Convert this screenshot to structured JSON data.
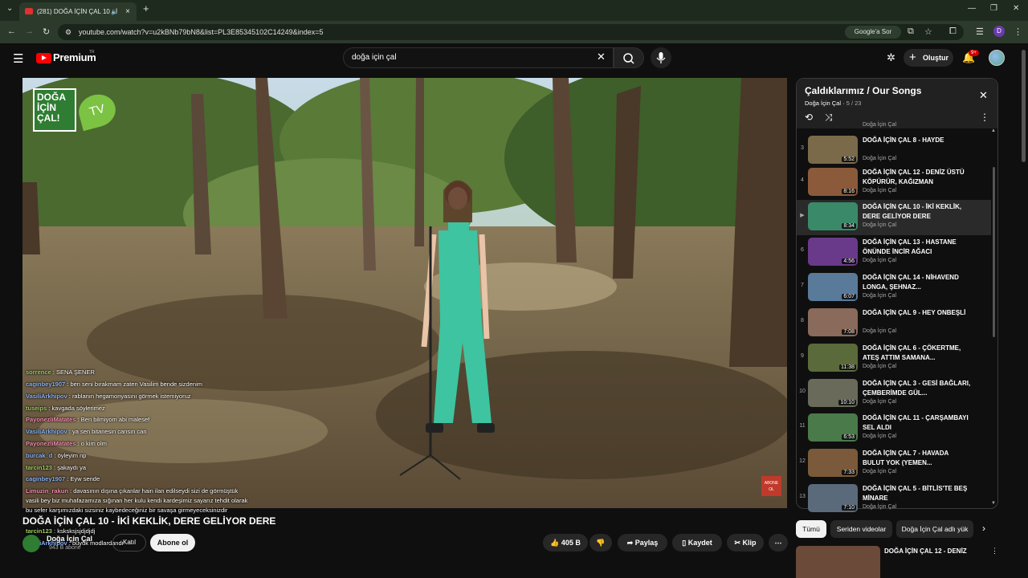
{
  "browser": {
    "tab_title": "(281) DOĞA İÇİN ÇAL 10 - İ",
    "url": "youtube.com/watch?v=u2kBNb79bN8&list=PL3E85345102C14249&index=5",
    "ask_google": "Google'a Sor",
    "profile_initial": "D"
  },
  "header": {
    "logo": "Premium",
    "logo_tr": "TR",
    "search_value": "doğa için çal",
    "create_label": "Oluştur",
    "notif_count": "9+"
  },
  "video": {
    "brand_text": "DOĞA İÇİN ÇAL!",
    "brand_tv": "TV",
    "abone_mark": "ABONE OL"
  },
  "chat": [
    {
      "user": "sorrence",
      "text": " : SENA ŞENER"
    },
    {
      "user": "caginbey1907",
      "text": " : ben seni bırakmam zaten Vasilim bende sizdenim"
    },
    {
      "user": "VasiliArkhipov",
      "text": " : rablanın hegamonyasını görmek istemiyoruz"
    },
    {
      "user": "tuseips",
      "text": " : kavgada söylerimez"
    },
    {
      "user": "PayonezliMatates",
      "text": " : Ben bilmiyom abi malesef"
    },
    {
      "user": "VasiliArkhipov",
      "text": " : ya sen bitanesin cansın can"
    },
    {
      "user": "PayonezliMatates",
      "text": " : o kim olm"
    },
    {
      "user": "burcak_d",
      "text": " : öyleyim np"
    },
    {
      "user": "tarcin123",
      "text": " : şakaydı ya"
    },
    {
      "user": "caginbey1907",
      "text": " : Eyw sende"
    },
    {
      "user": "Limuzin_rakun",
      "text": " : davasının dışına çıkanlar hain ilan edilseydi sizi de görmüştük"
    },
    {
      "user": "",
      "text": "vasili bey biz muhafazamıza sığınan her kulu kendi kardeşimiz sayarız tehdit olarak"
    },
    {
      "user": "",
      "text": "bu sefer karşımızdaki sizsiniz kaybedeceğiniz bir savaşa girmeyeceksinizdir"
    },
    {
      "user": "tarcin123",
      "text": " : ksksksjsjdjdjdj"
    },
    {
      "user": "VasiliArkhipov",
      "text": " : büyük modlardandı"
    }
  ],
  "meta": {
    "title": "DOĞA İÇİN ÇAL 10 - İKİ KEKLİK, DERE GELİYOR DERE",
    "channel": "Doğa İçin Çal",
    "subs": "943 B abone",
    "join": "Katıl",
    "subscribe": "Abone ol",
    "likes": "405 B",
    "share": "Paylaş",
    "save": "Kaydet",
    "clip": "Klip"
  },
  "playlist": {
    "title": "Çaldıklarımız / Our Songs",
    "channel": "Doğa İçin Çal",
    "position": "5 / 23",
    "items": [
      {
        "idx": "3",
        "title": "DOĞA İÇİN ÇAL 8 - HAYDE",
        "channel": "Doğa İçin Çal",
        "dur": "5:52",
        "color": "#7a6a4a"
      },
      {
        "idx": "4",
        "title": "DOĞA İÇİN ÇAL 12 - DENİZ ÜSTÜ KÖPÜRÜR, KAĞIZMAN",
        "channel": "Doğa İçin Çal",
        "dur": "8:16",
        "color": "#8a5a3a"
      },
      {
        "idx": "▶",
        "title": "DOĞA İÇİN ÇAL 10 - İKİ KEKLİK, DERE GELİYOR DERE",
        "channel": "Doğa İçin Çal",
        "dur": "8:34",
        "color": "#3a8a6a"
      },
      {
        "idx": "6",
        "title": "DOĞA İÇİN ÇAL 13 - HASTANE ÖNÜNDE İNCİR AĞACI",
        "channel": "Doğa İçin Çal",
        "dur": "4:56",
        "color": "#6a3a8a"
      },
      {
        "idx": "7",
        "title": "DOĞA İÇİN ÇAL 14 - NİHAVEND LONGA, ŞEHNAZ...",
        "channel": "Doğa İçin Çal",
        "dur": "6:07",
        "color": "#5a7a9a"
      },
      {
        "idx": "8",
        "title": "DOĞA İÇİN ÇAL 9 - HEY ONBEŞLİ",
        "channel": "Doğa İçin Çal",
        "dur": "7:08",
        "color": "#8a6a5a"
      },
      {
        "idx": "9",
        "title": "DOĞA İÇİN ÇAL 6 - ÇÖKERTME, ATEŞ ATTIM SAMANA...",
        "channel": "Doğa İçin Çal",
        "dur": "11:38",
        "color": "#5a6a3a"
      },
      {
        "idx": "10",
        "title": "DOĞA İÇİN ÇAL 3 - GESİ BAĞLARI, ÇEMBERİMDE GÜL...",
        "channel": "Doğa İçin Çal",
        "dur": "10:10",
        "color": "#6a6a5a"
      },
      {
        "idx": "11",
        "title": "DOĞA İÇİN ÇAL 11 - ÇARŞAMBAYI SEL ALDI",
        "channel": "Doğa İçin Çal",
        "dur": "6:53",
        "color": "#4a7a4a"
      },
      {
        "idx": "12",
        "title": "DOĞA İÇİN ÇAL 7 - HAVADA BULUT YOK (YEMEN...",
        "channel": "Doğa İçin Çal",
        "dur": "7:33",
        "color": "#7a5a3a"
      },
      {
        "idx": "13",
        "title": "DOĞA İÇİN ÇAL 5 - BİTLİS'TE BEŞ MİNARE",
        "channel": "Doğa İçin Çal",
        "dur": "7:10",
        "color": "#5a6a7a"
      }
    ]
  },
  "chips": [
    "Tümü",
    "Seriden videolar",
    "Doğa İçin Çal adlı yük"
  ],
  "recommended": {
    "title": "DOĞA İÇİN ÇAL 12 - DENİZ"
  }
}
